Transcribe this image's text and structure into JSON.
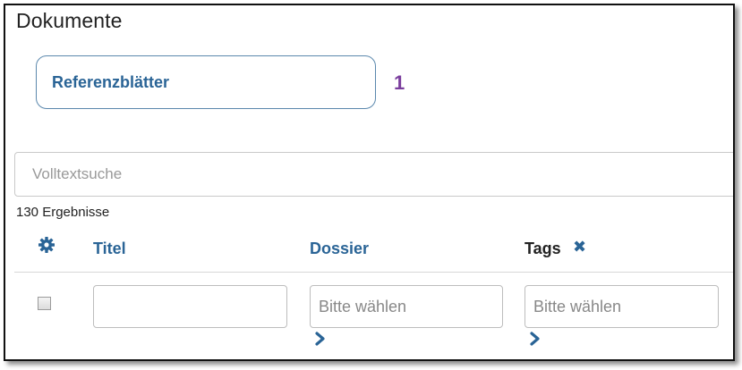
{
  "page": {
    "title": "Dokumente"
  },
  "reference_button": {
    "label": "Referenzblätter"
  },
  "annotation": {
    "marker": "1"
  },
  "search": {
    "placeholder": "Volltextsuche",
    "value": ""
  },
  "results": {
    "count_text": "130 Ergebnisse"
  },
  "table": {
    "settings_icon": "gear-icon",
    "columns": {
      "titel": "Titel",
      "dossier": "Dossier",
      "tags": "Tags"
    },
    "tags_clear_icon": "close-icon",
    "filters": {
      "titel": {
        "value": "",
        "placeholder": ""
      },
      "dossier": {
        "value": "",
        "placeholder": "Bitte wählen"
      },
      "tags": {
        "value": "",
        "placeholder": "Bitte wählen"
      }
    },
    "select_all_checked": false
  },
  "colors": {
    "link": "#2a6496",
    "marker": "#7a3e9d",
    "text": "#222222",
    "placeholder": "#999999"
  }
}
